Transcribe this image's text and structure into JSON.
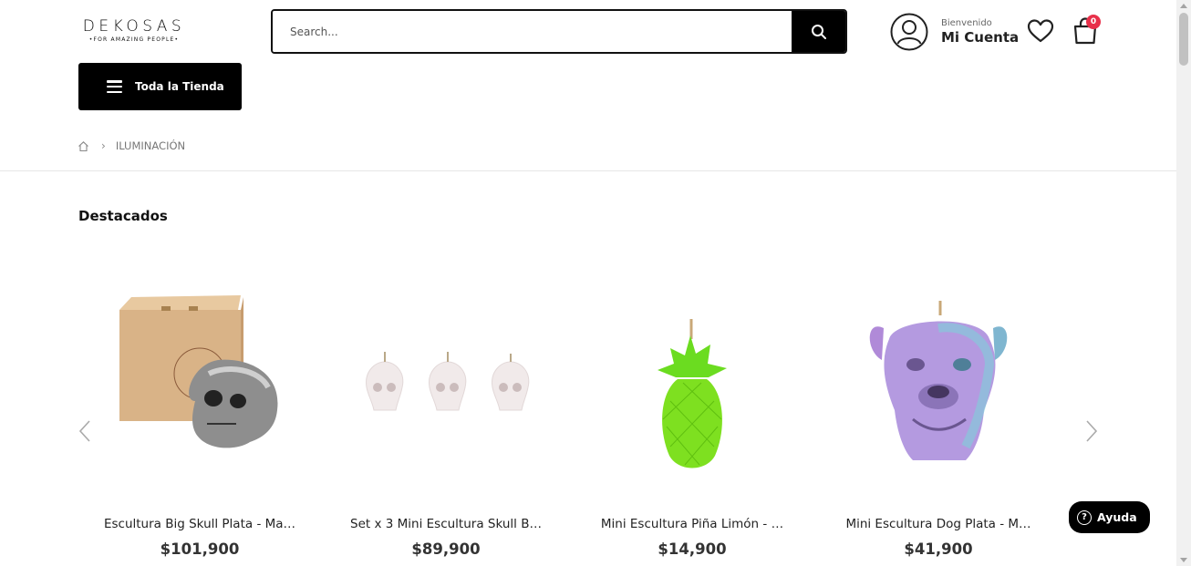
{
  "brand": {
    "name": "DEKOSAS",
    "tagline": "•FOR AMAZING PEOPLE•"
  },
  "search": {
    "placeholder": "Search..."
  },
  "account": {
    "welcome": "Bienvenido",
    "name": "Mi Cuenta"
  },
  "cart": {
    "count": "0"
  },
  "menu": {
    "label": "Toda la Tienda"
  },
  "breadcrumb": {
    "current": "ILUMINACIÓN"
  },
  "section": {
    "title": "Destacados"
  },
  "products": [
    {
      "title": "Escultura Big Skull Plata - Ma…",
      "price": "$101,900"
    },
    {
      "title": "Set x 3 Mini Escultura Skull B…",
      "price": "$89,900"
    },
    {
      "title": "Mini Escultura Piña Limón - …",
      "price": "$14,900"
    },
    {
      "title": "Mini Escultura Dog Plata - M…",
      "price": "$41,900"
    }
  ],
  "help": {
    "label": "Ayuda"
  },
  "colors": {
    "accent": "#000000",
    "badge": "#e8304a"
  }
}
